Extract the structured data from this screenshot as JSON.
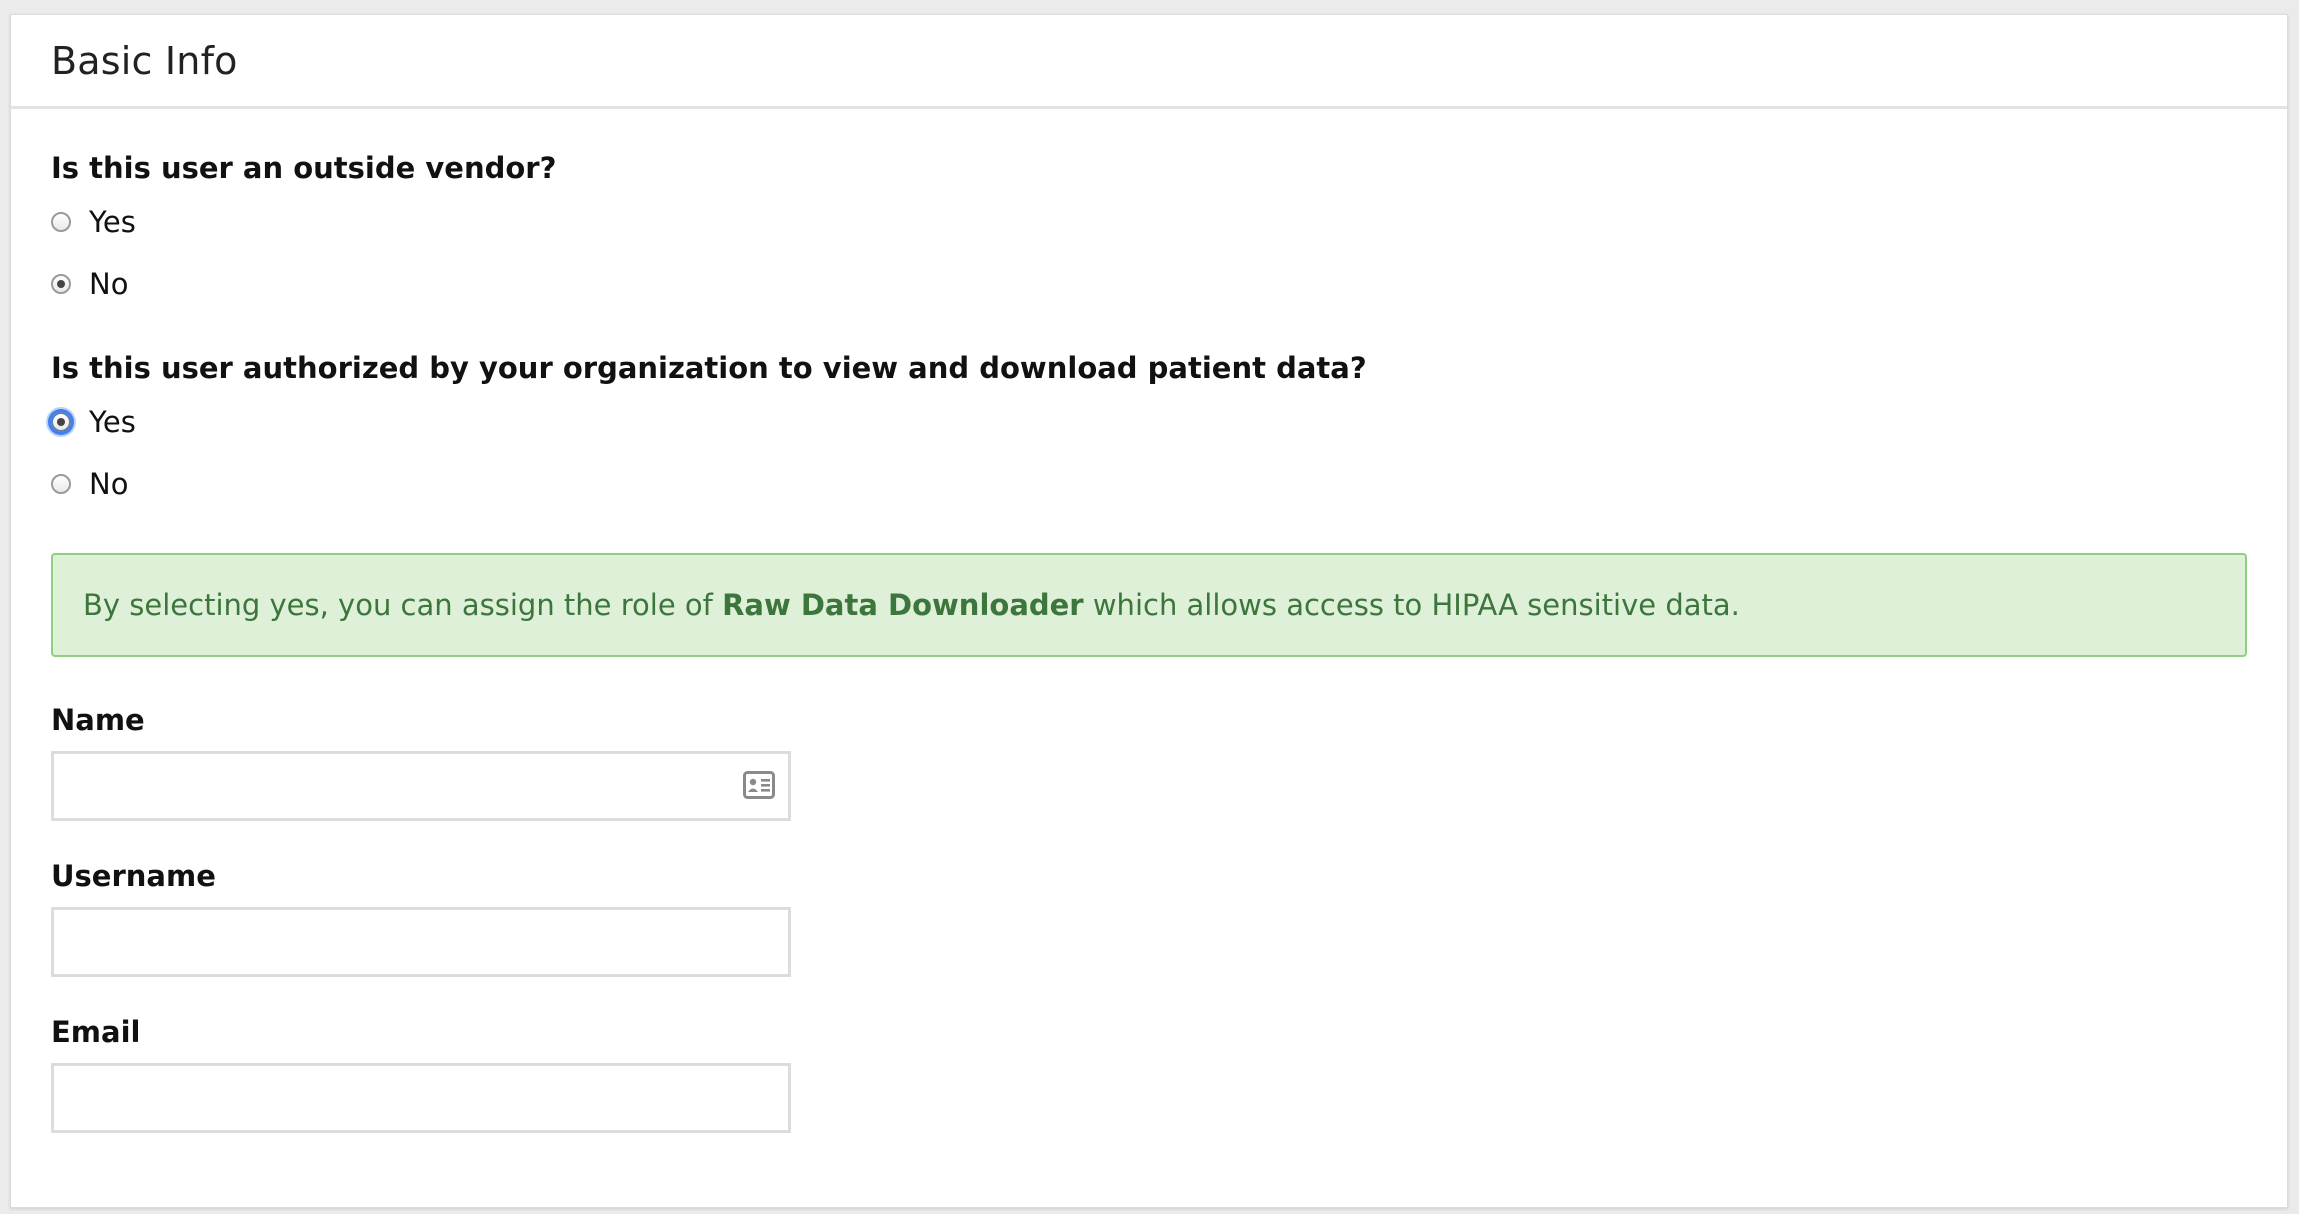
{
  "panel": {
    "title": "Basic Info"
  },
  "vendor_question": {
    "label": "Is this user an outside vendor?",
    "options": [
      {
        "label": "Yes",
        "checked": false
      },
      {
        "label": "No",
        "checked": true
      }
    ]
  },
  "authorized_question": {
    "label": "Is this user authorized by your organization to view and download patient data?",
    "options": [
      {
        "label": "Yes",
        "checked": true,
        "focused": true
      },
      {
        "label": "No",
        "checked": false
      }
    ]
  },
  "alert": {
    "text_before": "By selecting yes, you can assign the role of ",
    "role_name": "Raw Data Downloader",
    "text_after": " which allows access to HIPAA sensitive data.",
    "background_color": "#dff0d8",
    "text_color": "#3c763d"
  },
  "fields": {
    "name": {
      "label": "Name",
      "value": "",
      "icon": "contact-card-icon"
    },
    "username": {
      "label": "Username",
      "value": ""
    },
    "email": {
      "label": "Email",
      "value": ""
    }
  }
}
